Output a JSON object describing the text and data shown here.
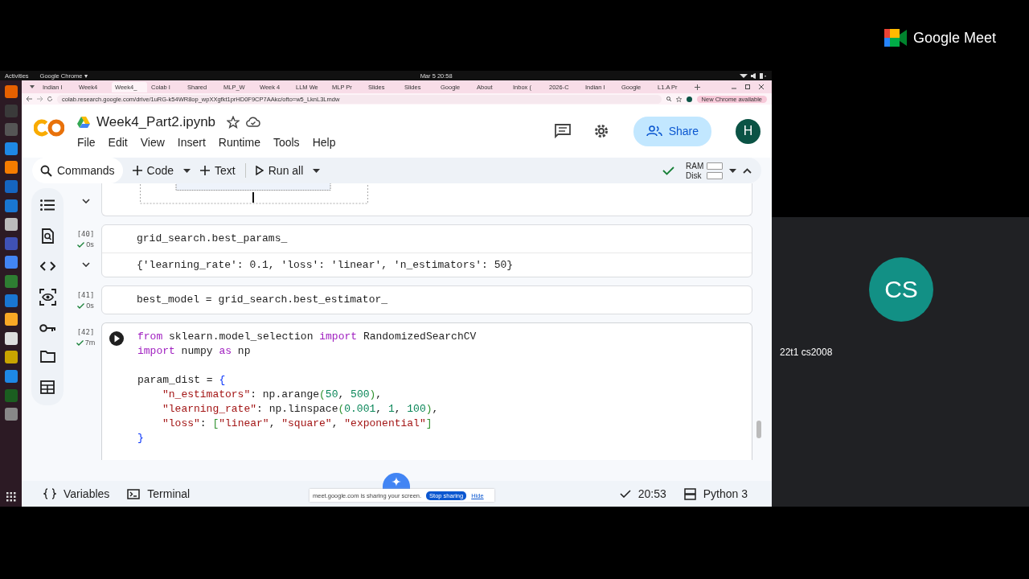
{
  "system_bar": {
    "activities": "Activities",
    "app": "Google Chrome ▾",
    "clock": "Mar 5 20:58"
  },
  "browser": {
    "tabs": [
      {
        "title": "Indian I",
        "selected": false
      },
      {
        "title": "Week4",
        "selected": false
      },
      {
        "title": "Week4_",
        "selected": true
      },
      {
        "title": "Colab I",
        "selected": false
      },
      {
        "title": "Shared",
        "selected": false
      },
      {
        "title": "MLP_W",
        "selected": false
      },
      {
        "title": "Week 4",
        "selected": false
      },
      {
        "title": "LLM We",
        "selected": false
      },
      {
        "title": "MLP Pr",
        "selected": false
      },
      {
        "title": "Slides",
        "selected": false
      },
      {
        "title": "Slides",
        "selected": false
      },
      {
        "title": "Google",
        "selected": false
      },
      {
        "title": "About",
        "selected": false
      },
      {
        "title": "Inbox (",
        "selected": false
      },
      {
        "title": "2026-C",
        "selected": false
      },
      {
        "title": "Indian I",
        "selected": false
      },
      {
        "title": "Google",
        "selected": false
      },
      {
        "title": "L1.A Pr",
        "selected": false
      }
    ],
    "url": "colab.research.google.com/drive/1uRG-k54WR8op_wpXXgfkt1prHD0F9CP7AAkc/ofto=w5_LknL3Lmdw",
    "update_badge": "New Chrome available"
  },
  "notebook": {
    "title": "Week4_Part2.ipynb",
    "menu": [
      "File",
      "Edit",
      "View",
      "Insert",
      "Runtime",
      "Tools",
      "Help"
    ],
    "share": "Share",
    "avatar": "H",
    "toolbar": {
      "commands": "Commands",
      "code": "Code",
      "text": "Text",
      "run_all": "Run all",
      "ram": "RAM",
      "disk": "Disk"
    },
    "cells": [
      {
        "kind": "widget"
      },
      {
        "kind": "code",
        "focused": false,
        "count": "[40]",
        "time": "0s",
        "lines": [
          {
            "tokens": [
              {
                "text": "grid_search.best_params_",
                "kind": "plain"
              }
            ]
          }
        ],
        "output": "{'learning_rate': 0.1, 'loss': 'linear', 'n_estimators': 50}"
      },
      {
        "kind": "code",
        "focused": false,
        "count": "[41]",
        "time": "0s",
        "lines": [
          {
            "tokens": [
              {
                "text": "best_model = grid_search.best_estimator_",
                "kind": "plain"
              }
            ]
          }
        ]
      },
      {
        "kind": "code",
        "focused": true,
        "count": "[42]",
        "time": "7m",
        "lines": [
          {
            "tokens": [
              {
                "text": "from",
                "kind": "keyword"
              },
              {
                "text": " sklearn.model_selection ",
                "kind": "plain"
              },
              {
                "text": "import",
                "kind": "keyword"
              },
              {
                "text": " RandomizedSearchCV",
                "kind": "plain"
              }
            ]
          },
          {
            "tokens": [
              {
                "text": "import",
                "kind": "keyword"
              },
              {
                "text": " numpy ",
                "kind": "plain"
              },
              {
                "text": "as",
                "kind": "keyword"
              },
              {
                "text": " np",
                "kind": "plain"
              }
            ]
          },
          {
            "spaced": true,
            "tokens": [
              {
                "text": "param_dist = ",
                "kind": "plain"
              },
              {
                "text": "{",
                "kind": "brace"
              }
            ]
          },
          {
            "indented": true,
            "tokens": [
              {
                "text": "\"n_estimators\"",
                "kind": "string"
              },
              {
                "text": ": np.arange",
                "kind": "plain"
              },
              {
                "text": "(",
                "kind": "paren"
              },
              {
                "text": "50",
                "kind": "number"
              },
              {
                "text": ", ",
                "kind": "plain"
              },
              {
                "text": "500",
                "kind": "number"
              },
              {
                "text": ")",
                "kind": "paren"
              },
              {
                "text": ",",
                "kind": "plain"
              }
            ]
          },
          {
            "indented": true,
            "tokens": [
              {
                "text": "\"learning_rate\"",
                "kind": "string"
              },
              {
                "text": ": np.linspace",
                "kind": "plain"
              },
              {
                "text": "(",
                "kind": "paren"
              },
              {
                "text": "0.001",
                "kind": "number"
              },
              {
                "text": ", ",
                "kind": "plain"
              },
              {
                "text": "1",
                "kind": "number"
              },
              {
                "text": ", ",
                "kind": "plain"
              },
              {
                "text": "100",
                "kind": "number"
              },
              {
                "text": ")",
                "kind": "paren"
              },
              {
                "text": ",",
                "kind": "plain"
              }
            ]
          },
          {
            "indented": true,
            "tokens": [
              {
                "text": "\"loss\"",
                "kind": "string"
              },
              {
                "text": ": ",
                "kind": "plain"
              },
              {
                "text": "[",
                "kind": "paren"
              },
              {
                "text": "\"linear\"",
                "kind": "string"
              },
              {
                "text": ", ",
                "kind": "plain"
              },
              {
                "text": "\"square\"",
                "kind": "string"
              },
              {
                "text": ", ",
                "kind": "plain"
              },
              {
                "text": "\"exponential\"",
                "kind": "string"
              },
              {
                "text": "]",
                "kind": "paren"
              }
            ]
          },
          {
            "tokens": [
              {
                "text": "}",
                "kind": "brace"
              }
            ]
          }
        ]
      }
    ],
    "status_bar": {
      "variables": "Variables",
      "terminal": "Terminal",
      "time": "20:53",
      "runtime": "Python 3"
    }
  },
  "share_notice": {
    "message": "meet.google.com is sharing your screen.",
    "stop": "Stop sharing",
    "hide": "Hide"
  },
  "meet": {
    "brand": "Google Meet",
    "participant": {
      "initials": "CS",
      "name": "22t1 cs2008"
    }
  }
}
